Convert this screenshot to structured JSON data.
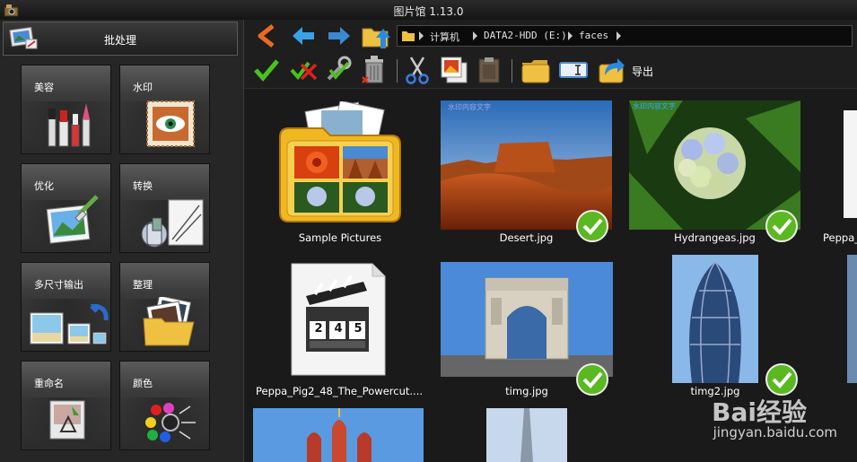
{
  "window": {
    "title": "图片馆 1.13.0"
  },
  "sidebar": {
    "batch_label": "批处理",
    "tiles": [
      {
        "label": "美容"
      },
      {
        "label": "水印"
      },
      {
        "label": "优化"
      },
      {
        "label": "转换"
      },
      {
        "label": "多尺寸输出"
      },
      {
        "label": "整理"
      },
      {
        "label": "重命名"
      },
      {
        "label": "颜色"
      }
    ]
  },
  "address_bar": {
    "segments": [
      "计算机",
      "DATA2-HDD (E:)",
      "faces"
    ]
  },
  "toolbar": {
    "export_label": "导出"
  },
  "items": [
    {
      "caption": "Sample Pictures",
      "checked": false
    },
    {
      "caption": "Desert.jpg",
      "checked": true
    },
    {
      "caption": "Hydrangeas.jpg",
      "checked": true
    },
    {
      "caption": "Peppa_",
      "checked": false
    },
    {
      "caption": "Peppa_Pig2_48_The_Powercut....",
      "checked": false
    },
    {
      "caption": "timg.jpg",
      "checked": true
    },
    {
      "caption": "timg2.jpg",
      "checked": true
    }
  ],
  "clapper_numbers": [
    "2",
    "4",
    "5"
  ],
  "thumb_watermark_text": "水印内容文字",
  "watermark": {
    "brand": "Bai经验",
    "url": "jingyan.baidu.com"
  }
}
